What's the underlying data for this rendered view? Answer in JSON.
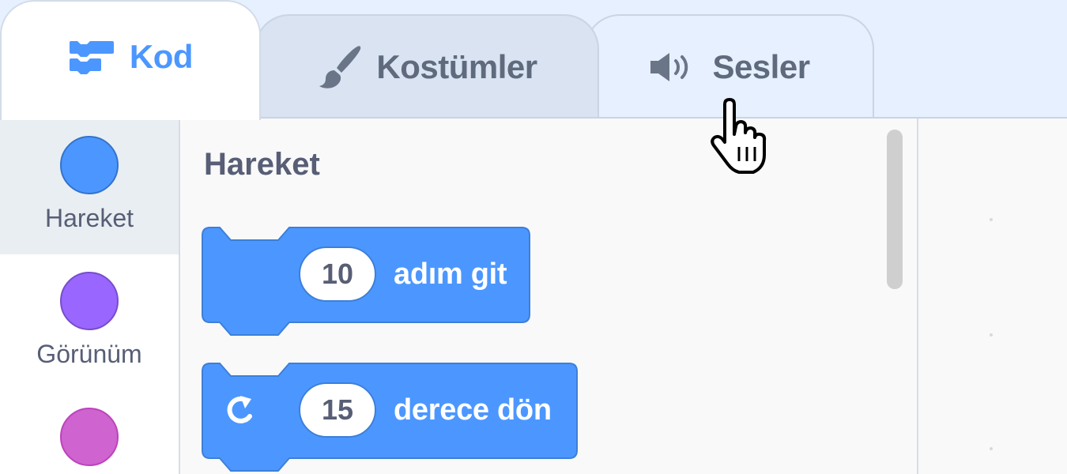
{
  "tabs": {
    "code": {
      "label": "Kod",
      "icon": "code-blocks-icon",
      "selected": true
    },
    "costumes": {
      "label": "Kostümler",
      "icon": "paintbrush-icon",
      "selected": false
    },
    "sounds": {
      "label": "Sesler",
      "icon": "speaker-icon",
      "selected": false
    }
  },
  "categories": [
    {
      "label": "Hareket",
      "color": "#4c97ff",
      "selected": true
    },
    {
      "label": "Görünüm",
      "color": "#9966ff",
      "selected": false
    },
    {
      "label": "",
      "color": "#cf63cf",
      "selected": false
    }
  ],
  "palette": {
    "section_title": "Hareket",
    "blocks": [
      {
        "input": "10",
        "text": "adım git",
        "icon": ""
      },
      {
        "input": "15",
        "text": "derece dön",
        "icon": "rotate-clockwise-icon"
      }
    ]
  },
  "colors": {
    "accent": "#4c97ff",
    "block_motion": "#4c97ff",
    "block_border": "#3d7fd9",
    "text_muted": "#575e75",
    "tab_background": "#e6f0ff"
  },
  "cursor": {
    "type": "pointing-hand"
  }
}
